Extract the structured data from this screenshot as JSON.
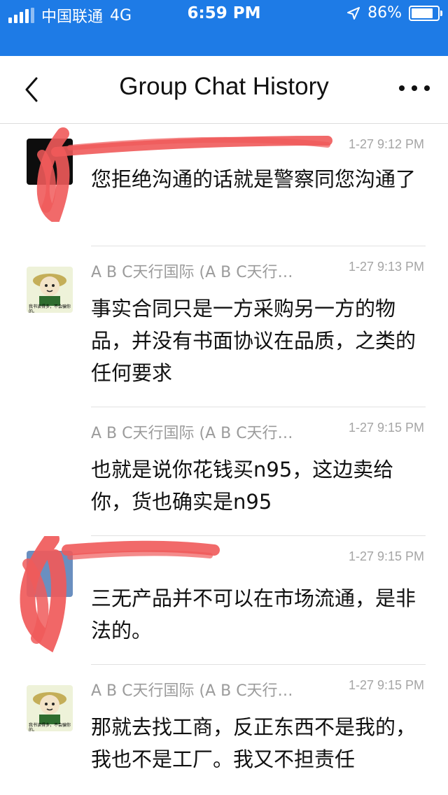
{
  "status_bar": {
    "carrier": "中国联通",
    "network": "4G",
    "time": "6:59 PM",
    "battery": "86%",
    "battery_level": 0.86
  },
  "nav": {
    "title": "Group Chat History",
    "back_icon": "chevron-left-icon",
    "more_icon": "more-horizontal-icon"
  },
  "messages": [
    {
      "name": "",
      "time": "1-27 9:12 PM",
      "text": "您拒绝沟通的话就是警察同您沟通了",
      "redacted": true
    },
    {
      "name": "A B C天行国际 (A B C天行…",
      "time": "1-27 9:13 PM",
      "text": "事实合同只是一方采购另一方的物品，并没有书面协议在品质，之类的任何要求",
      "avatar_caption": "我书读得多，不会骗你的。"
    },
    {
      "name": "A B C天行国际 (A B C天行…",
      "time": "1-27 9:15 PM",
      "text": "也就是说你花钱买n95，这边卖给你，货也确实是n95"
    },
    {
      "name": "",
      "time": "1-27 9:15 PM",
      "text": "三无产品并不可以在市场流通，是非法的。",
      "redacted": true
    },
    {
      "name": "A B C天行国际 (A B C天行…",
      "time": "1-27 9:15 PM",
      "text": "那就去找工商，反正东西不是我的，我也不是工厂。我又不担责任",
      "avatar_caption": "我书读得多，不会骗你的。"
    }
  ],
  "colors": {
    "status_bar_bg": "#1e7be6",
    "redaction": "#f05a5a",
    "meta_text": "#9b9b9b"
  }
}
